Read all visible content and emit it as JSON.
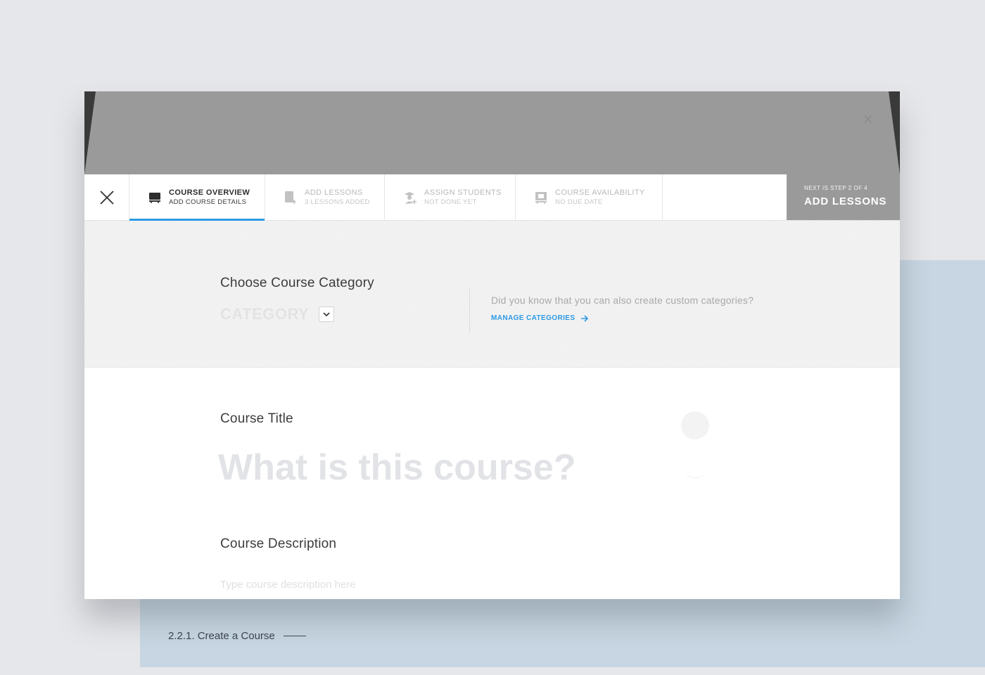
{
  "caption": {
    "text": "2.2.1. Create a Course"
  },
  "modal": {
    "close_icon": "close-icon",
    "steps": [
      {
        "title": "Course Overview",
        "subtitle": "Add course details",
        "icon": "monitor-icon",
        "active": true
      },
      {
        "title": "Add Lessons",
        "subtitle": "3 lessons added",
        "icon": "add-document-icon",
        "active": false
      },
      {
        "title": "Assign Students",
        "subtitle": "Not done yet",
        "icon": "add-student-icon",
        "active": false
      },
      {
        "title": "Course Availability",
        "subtitle": "No due date",
        "icon": "calendar-board-icon",
        "active": false
      }
    ],
    "next": {
      "small": "Next is step 2 of 4",
      "label": "Add Lessons"
    }
  },
  "category": {
    "label": "Choose Course Category",
    "value": "CATEGORY",
    "hint": "Did you know that you can also create custom categories?",
    "manage_link": "Manage Categories"
  },
  "course_title": {
    "label": "Course Title",
    "placeholder": "What is this course?"
  },
  "course_description": {
    "label": "Course Description",
    "placeholder": "Type course description here"
  },
  "colors": {
    "accent": "#2d9ae6",
    "hero": "#9a9a9a",
    "background_panel": "#c7d6e2"
  }
}
